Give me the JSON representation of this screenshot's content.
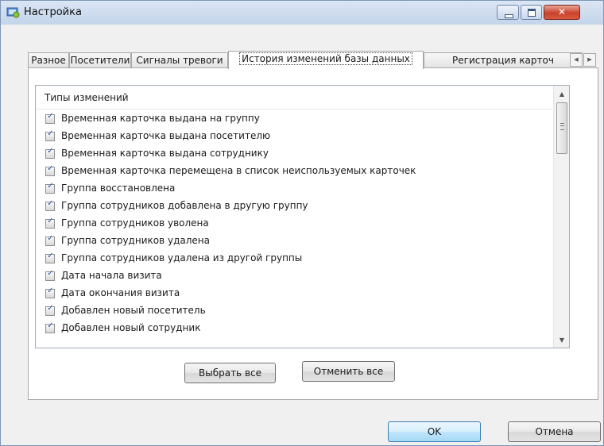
{
  "window": {
    "title": "Настройка",
    "close_glyph": "✕"
  },
  "tabs": [
    "Разное",
    "Посетители",
    "Сигналы тревоги",
    "История изменений базы данных",
    "Регистрация карточ"
  ],
  "active_tab_index": 3,
  "list": {
    "header": "Типы изменений",
    "items": [
      "Временная карточка выдана на группу",
      "Временная карточка выдана посетителю",
      "Временная карточка выдана сотруднику",
      "Временная карточка перемещена в список неиспользуемых карточек",
      "Группа восстановлена",
      "Группа сотрудников добавлена в другую группу",
      "Группа сотрудников уволена",
      "Группа сотрудников удалена",
      "Группа сотрудников удалена из другой группы",
      "Дата начала визита",
      "Дата окончания визита",
      "Добавлен новый посетитель",
      "Добавлен новый сотрудник"
    ],
    "checked": true,
    "check_glyph": "✓"
  },
  "buttons": {
    "select_all": "Выбрать все",
    "deselect_all": "Отменить все",
    "ok": "OK",
    "cancel": "Отмена"
  },
  "icons": {
    "app": "settings-app-icon",
    "minimize": "minimize-icon",
    "maximize": "maximize-icon",
    "close": "close-icon",
    "tab_left": "chevron-left-icon",
    "tab_right": "chevron-right-icon",
    "scroll_up": "scroll-up-icon",
    "scroll_down": "scroll-down-icon"
  },
  "colors": {
    "titlebar": "#c3d4ea",
    "close_button": "#c8432c",
    "check": "#2a55a8",
    "ok_border": "#3c7fb1"
  }
}
